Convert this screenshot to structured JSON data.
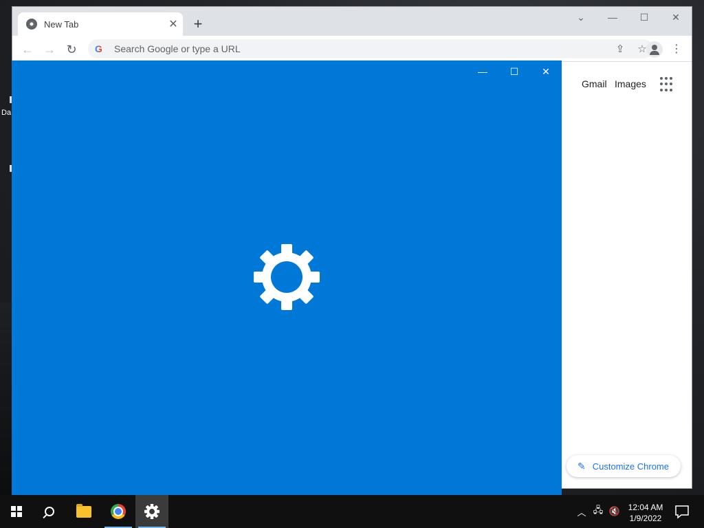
{
  "desktop": {
    "icon_label": "Da"
  },
  "chrome": {
    "tab": {
      "title": "New Tab",
      "close_glyph": "✕"
    },
    "new_tab_glyph": "+",
    "window_controls": {
      "tabsearch": "⌄",
      "minimize": "—",
      "maximize": "☐",
      "close": "✕"
    },
    "toolbar": {
      "back": "←",
      "forward": "→",
      "reload": "↻",
      "omnibox_logo": "G",
      "omnibox_placeholder": "Search Google or type a URL",
      "share": "⇪",
      "bookmark": "☆",
      "menu": "⋮"
    },
    "content": {
      "links": {
        "gmail": "Gmail",
        "images": "Images"
      },
      "customize_label": "Customize Chrome",
      "customize_icon": "✎"
    }
  },
  "settings_window": {
    "controls": {
      "minimize": "—",
      "maximize": "☐",
      "close": "✕"
    },
    "background": "#0078d7",
    "splash_icon": "gear-icon"
  },
  "taskbar": {
    "items": [
      "start",
      "search",
      "file-explorer",
      "chrome",
      "settings"
    ],
    "tray": {
      "chevron": "︿",
      "network": "🖧",
      "volume": "🔇"
    },
    "clock": {
      "time": "12:04 AM",
      "date": "1/9/2022"
    }
  }
}
